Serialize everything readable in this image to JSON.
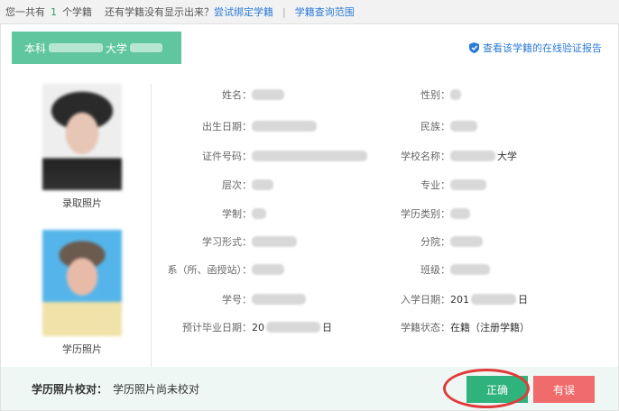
{
  "topbar": {
    "prefix": "您一共有",
    "count": "1",
    "suffix": "个学籍",
    "question": "还有学籍没有显示出来？",
    "bind_link": "尝试绑定学籍",
    "separator": "|",
    "scope_link": "学籍查询范围"
  },
  "school_tab": {
    "level": "本科",
    "school_suffix": "大学"
  },
  "verify_link": "查看该学籍的在线验证报告",
  "photos": {
    "admission_label": "录取照片",
    "education_label": "学历照片"
  },
  "fields": {
    "left": [
      {
        "label": "姓名：",
        "value": ""
      },
      {
        "label": "出生日期：",
        "value": ""
      },
      {
        "label": "证件号码：",
        "value": ""
      },
      {
        "label": "层次：",
        "value": ""
      },
      {
        "label": "学制：",
        "value": ""
      },
      {
        "label": "学习形式：",
        "value": ""
      },
      {
        "label": "系（所、函授站）：",
        "value": ""
      },
      {
        "label": "学号：",
        "value": ""
      },
      {
        "label": "预计毕业日期：",
        "value_prefix": "20",
        "value_suffix": "日"
      }
    ],
    "right": [
      {
        "label": "性别：",
        "value": ""
      },
      {
        "label": "民族：",
        "value": ""
      },
      {
        "label": "学校名称：",
        "value_suffix": "大学"
      },
      {
        "label": "专业：",
        "value": ""
      },
      {
        "label": "学历类别：",
        "value": ""
      },
      {
        "label": "分院：",
        "value": ""
      },
      {
        "label": "班级：",
        "value": ""
      },
      {
        "label": "入学日期：",
        "value_prefix": "201",
        "value_suffix": "日"
      },
      {
        "label": "学籍状态：",
        "value": "在籍（注册学籍）"
      }
    ]
  },
  "footer": {
    "check_label": "学历照片校对：",
    "check_value": "学历照片尚未校对",
    "correct_button": "正确",
    "wrong_button": "有误"
  },
  "colors": {
    "tab_green": "#5fc6a0",
    "ok_green": "#2fb27b",
    "err_red": "#f06b6b",
    "link_blue": "#2b7bd6",
    "highlight_ring": "#e23a3a"
  }
}
